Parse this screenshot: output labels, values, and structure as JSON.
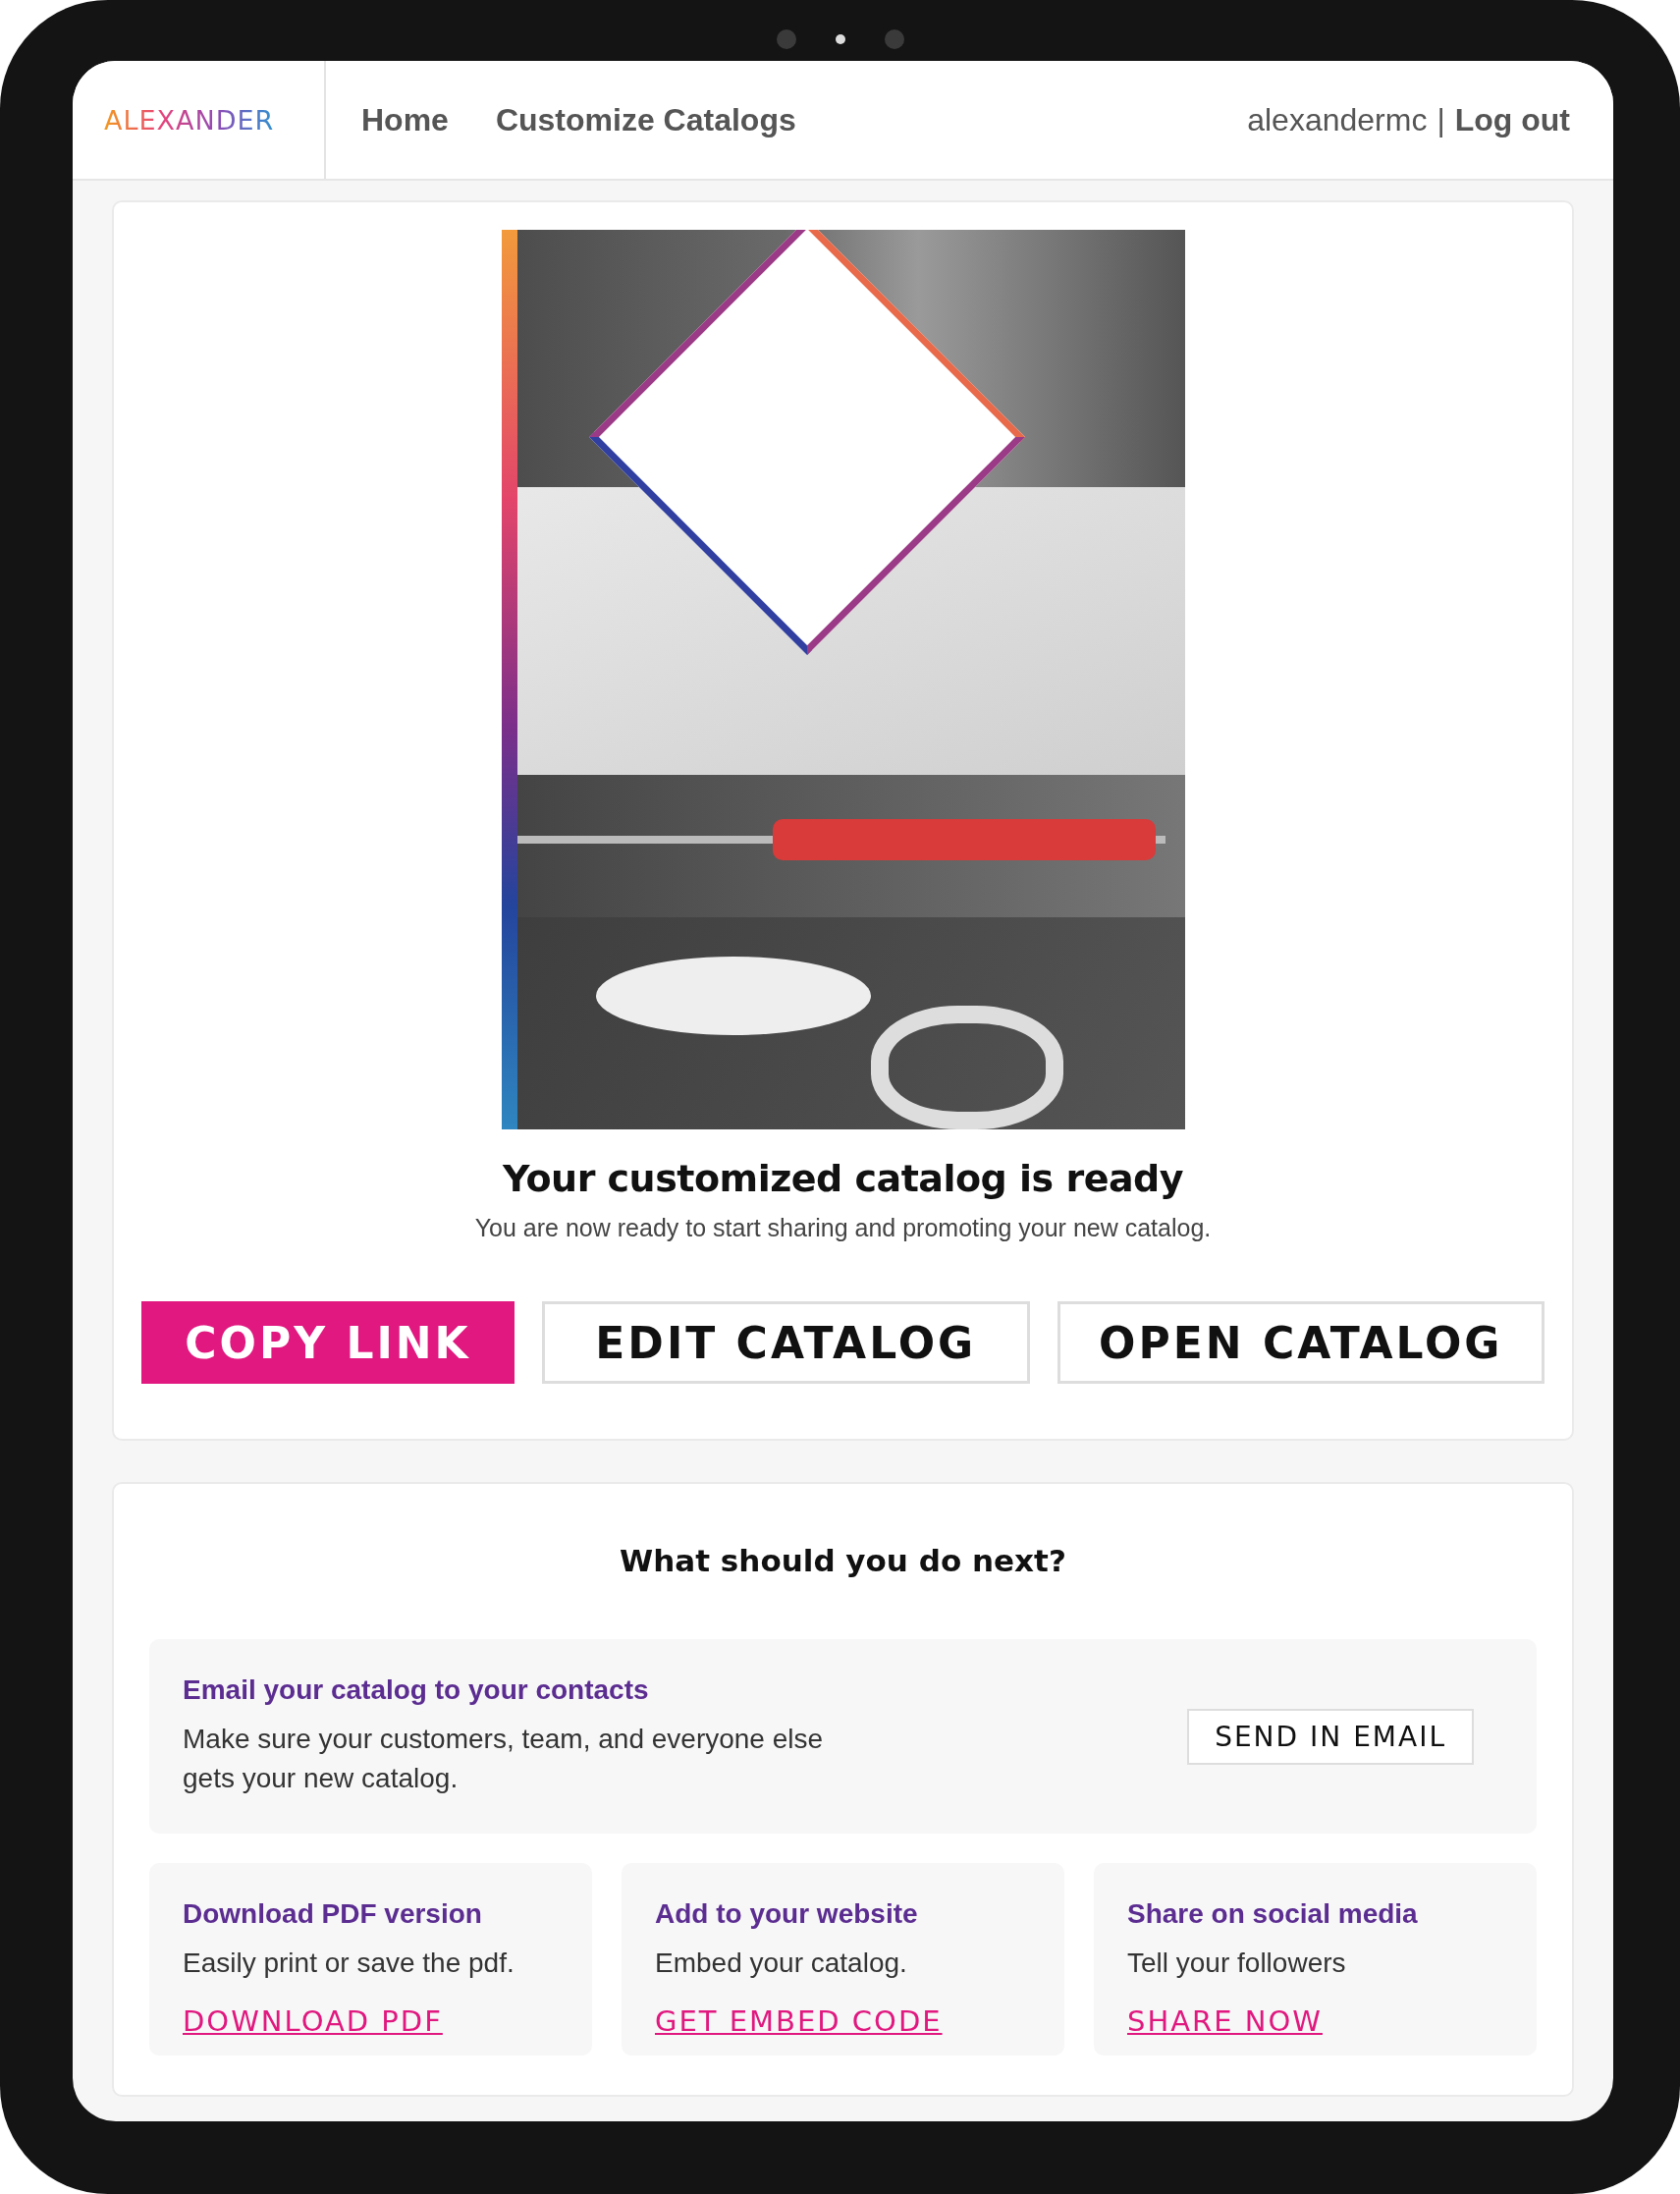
{
  "header": {
    "logo": "ALEXANDER",
    "nav": [
      {
        "label": "Home"
      },
      {
        "label": "Customize Catalogs"
      }
    ],
    "username": "alexandermc",
    "separator": "|",
    "logout": "Log out"
  },
  "ready_card": {
    "title": "Your customized catalog is ready",
    "subtitle": "You are now ready to start sharing and promoting your new catalog.",
    "buttons": [
      {
        "label": "COPY LINK",
        "kind": "primary"
      },
      {
        "label": "EDIT CATALOG",
        "kind": "outline"
      },
      {
        "label": "OPEN CATALOG",
        "kind": "outline"
      }
    ]
  },
  "next_card": {
    "title": "What should you do next?",
    "email": {
      "title": "Email your catalog to your contacts",
      "text": "Make sure your customers, team, and everyone else gets your new catalog.",
      "button": "SEND IN EMAIL"
    },
    "options": [
      {
        "title": "Download PDF version",
        "text": "Easily print or save the pdf.",
        "link": "DOWNLOAD PDF"
      },
      {
        "title": "Add to your website",
        "text": "Embed your catalog.",
        "link": "GET EMBED CODE"
      },
      {
        "title": "Share on social media",
        "text": "Tell your followers",
        "link": "SHARE NOW"
      }
    ]
  }
}
